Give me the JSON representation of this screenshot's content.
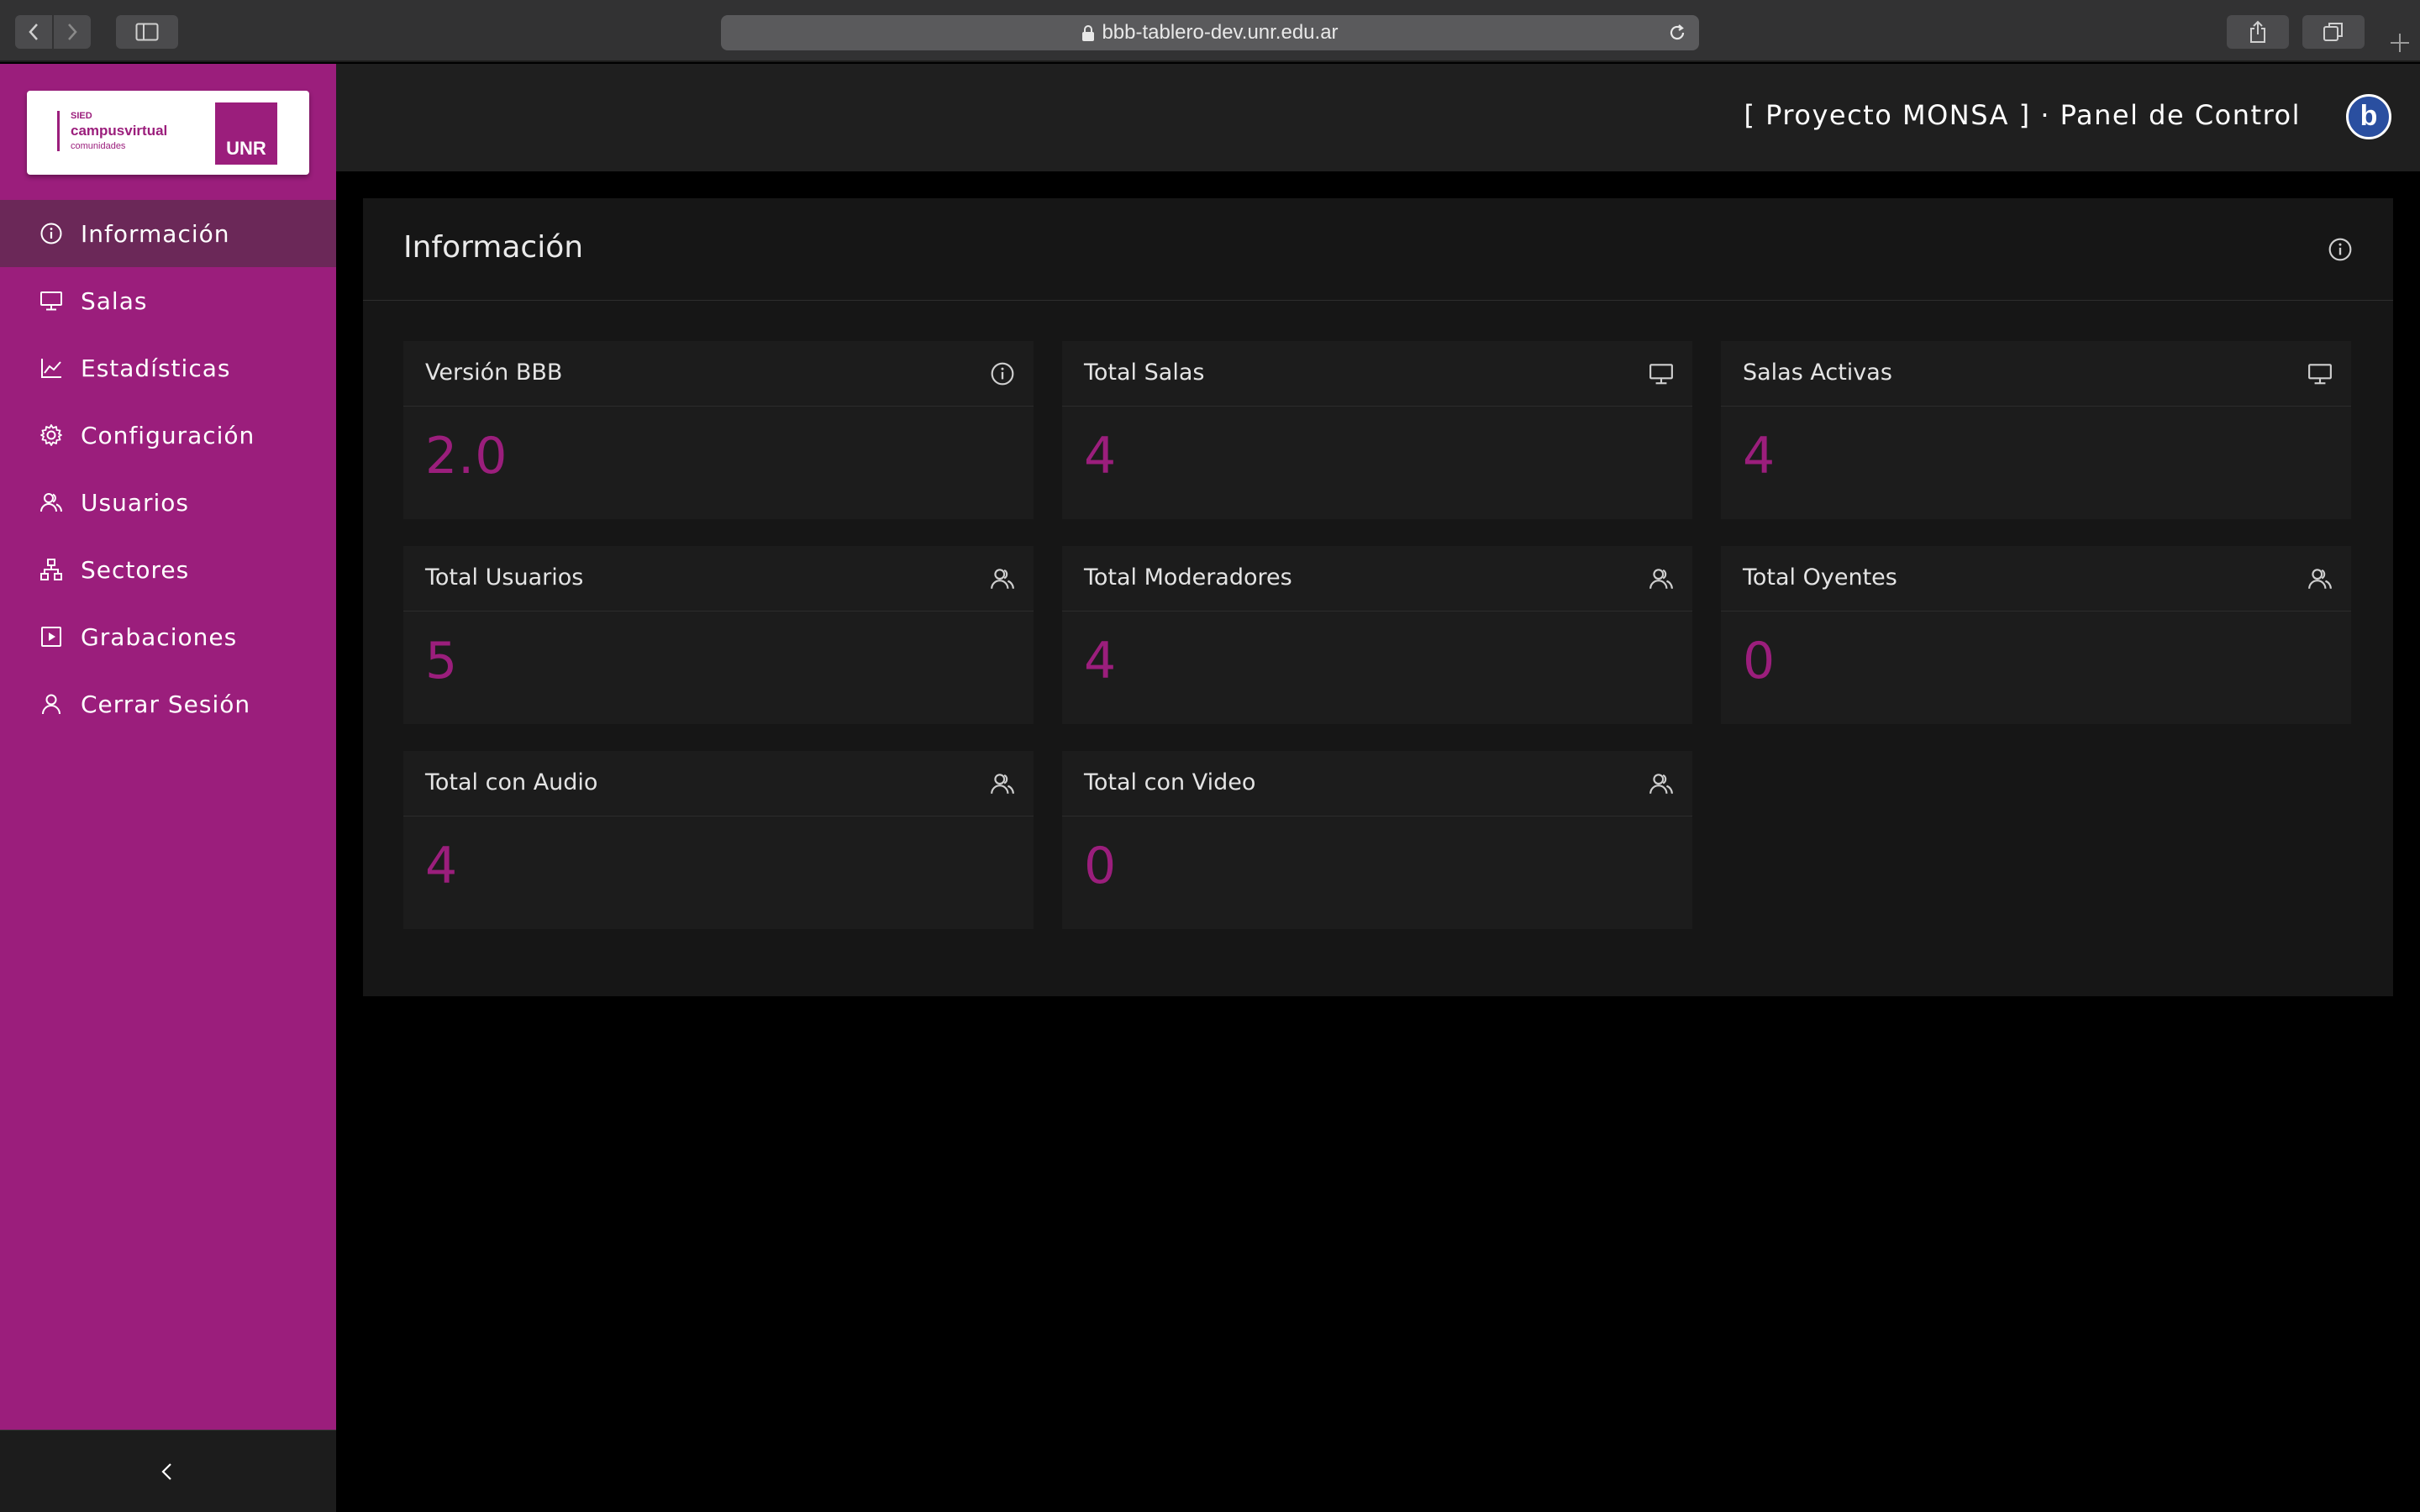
{
  "browser": {
    "url": "bbb-tablero-dev.unr.edu.ar"
  },
  "logo": {
    "sied": "SIED",
    "campus": "campusvirtual",
    "comunidades": "comunidades",
    "unr": "UNR"
  },
  "sidebar": {
    "items": [
      {
        "label": "Información",
        "icon": "info-icon",
        "active": true
      },
      {
        "label": "Salas",
        "icon": "monitor-icon",
        "active": false
      },
      {
        "label": "Estadísticas",
        "icon": "chart-line-icon",
        "active": false
      },
      {
        "label": "Configuración",
        "icon": "gear-icon",
        "active": false
      },
      {
        "label": "Usuarios",
        "icon": "users-icon",
        "active": false
      },
      {
        "label": "Sectores",
        "icon": "sitemap-icon",
        "active": false
      },
      {
        "label": "Grabaciones",
        "icon": "play-icon",
        "active": false
      },
      {
        "label": "Cerrar Sesión",
        "icon": "user-icon",
        "active": false
      }
    ]
  },
  "header": {
    "title": "[ Proyecto MONSA ] · Panel de Control",
    "logo_letter": "b"
  },
  "panel": {
    "title": "Información"
  },
  "cards": [
    {
      "title": "Versión BBB",
      "value": "2.0",
      "icon": "info-icon"
    },
    {
      "title": "Total Salas",
      "value": "4",
      "icon": "monitor-icon"
    },
    {
      "title": "Salas Activas",
      "value": "4",
      "icon": "monitor-icon"
    },
    {
      "title": "Total Usuarios",
      "value": "5",
      "icon": "users-icon"
    },
    {
      "title": "Total Moderadores",
      "value": "4",
      "icon": "users-icon"
    },
    {
      "title": "Total Oyentes",
      "value": "0",
      "icon": "users-icon"
    },
    {
      "title": "Total con Audio",
      "value": "4",
      "icon": "users-icon"
    },
    {
      "title": "Total con Video",
      "value": "0",
      "icon": "users-icon"
    }
  ],
  "colors": {
    "accent": "#9b1e7c",
    "sidebar_active": "#6b2858",
    "panel_bg": "#161616",
    "card_bg": "#1c1c1c"
  }
}
